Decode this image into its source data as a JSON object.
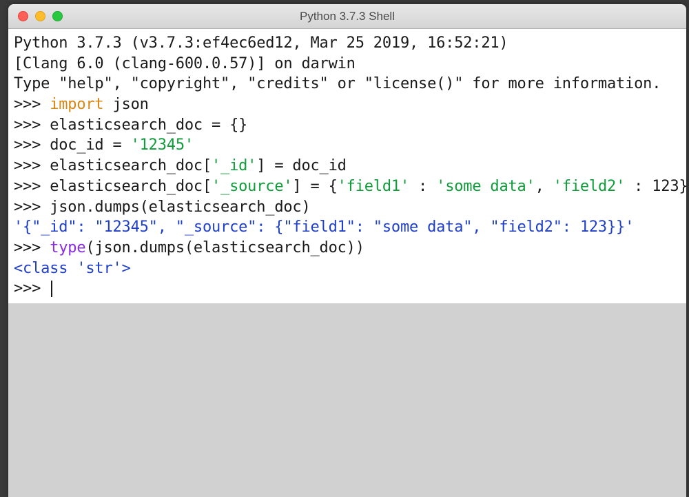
{
  "window": {
    "title": "Python 3.7.3 Shell"
  },
  "banner": {
    "line1": "Python 3.7.3 (v3.7.3:ef4ec6ed12, Mar 25 2019, 16:52:21) ",
    "line2": "[Clang 6.0 (clang-600.0.57)] on darwin",
    "line3": "Type \"help\", \"copyright\", \"credits\" or \"license()\" for more information."
  },
  "session": {
    "prompt": ">>> ",
    "l1": {
      "kw": "import",
      "rest": " json"
    },
    "l2": "elasticsearch_doc = {}",
    "l3": {
      "a": "doc_id = ",
      "s": "'12345'"
    },
    "l4": {
      "a": "elasticsearch_doc[",
      "s1": "'_id'",
      "b": "] = doc_id"
    },
    "l5": {
      "a": "elasticsearch_doc[",
      "s1": "'_source'",
      "b": "] = {",
      "s2": "'field1'",
      "c": " : ",
      "s3": "'some data'",
      "d": ", ",
      "s4": "'field2'",
      "e": " : 123}"
    },
    "l6": "json.dumps(elasticsearch_doc)",
    "out1": "'{\"_id\": \"12345\", \"_source\": {\"field1\": \"some data\", \"field2\": 123}}'",
    "l7": {
      "fn": "type",
      "rest": "(json.dumps(elasticsearch_doc))"
    },
    "out2": "<class 'str'>"
  }
}
